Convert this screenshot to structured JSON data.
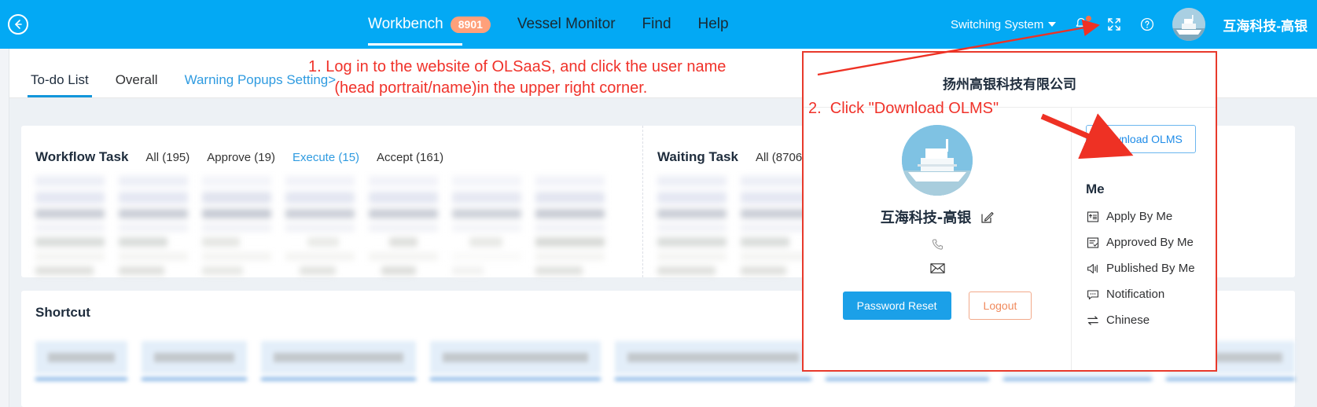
{
  "header": {
    "back_icon": "back-arrow-icon",
    "nav": [
      {
        "label": "Workbench",
        "badge": "8901",
        "active": true
      },
      {
        "label": "Vessel Monitor",
        "active": false
      },
      {
        "label": "Find",
        "active": false
      },
      {
        "label": "Help",
        "active": false
      }
    ],
    "switch_system": "Switching System",
    "icons": [
      "bell-icon",
      "fullscreen-icon",
      "help-circle-icon"
    ],
    "user_name": "互海科技-高银",
    "avatar": "ship-avatar"
  },
  "tabs": [
    {
      "label": "To-do List",
      "active": true,
      "type": "tab"
    },
    {
      "label": "Overall",
      "active": false,
      "type": "tab"
    },
    {
      "label": "Warning Popups Setting>",
      "active": false,
      "type": "link"
    }
  ],
  "workflow": {
    "title": "Workflow Task",
    "filters": [
      {
        "label": "All (195)",
        "selected": false
      },
      {
        "label": "Approve (19)",
        "selected": false
      },
      {
        "label": "Execute (15)",
        "selected": true
      },
      {
        "label": "Accept (161)",
        "selected": false
      }
    ]
  },
  "waiting": {
    "title": "Waiting Task",
    "filters": [
      {
        "label": "All (8706",
        "selected": false
      }
    ]
  },
  "shortcut": {
    "title": "Shortcut"
  },
  "dropdown": {
    "company": "扬州高银科技有限公司",
    "user_name": "互海科技-高银",
    "edit_icon": "edit-icon",
    "phone_icon": "phone-icon",
    "mail_icon": "mail-icon",
    "password_reset": "Password Reset",
    "logout": "Logout",
    "download_olms": "Download OLMS",
    "me_title": "Me",
    "me_items": [
      {
        "label": "Apply By Me",
        "icon": "apply-icon"
      },
      {
        "label": "Approved By Me",
        "icon": "approved-icon"
      },
      {
        "label": "Published By Me",
        "icon": "megaphone-icon"
      },
      {
        "label": "Notification",
        "icon": "notification-icon"
      },
      {
        "label": "Chinese",
        "icon": "language-switch-icon"
      }
    ]
  },
  "annotations": {
    "step1": "1. Log in to the website of OLSaaS, and click the user name\n      (head portrait/name)in the upper right corner.",
    "step2": "2.  Click \"Download OLMS\""
  },
  "colors": {
    "header_blue": "#03a9f4",
    "accent_blue": "#1ba0e8",
    "link_blue": "#2f9be0",
    "annotation_red": "#f0322a",
    "badge_orange": "#ffa07a"
  }
}
